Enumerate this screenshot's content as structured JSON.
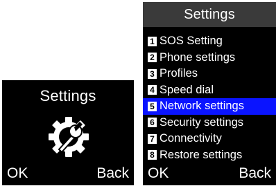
{
  "left_screen": {
    "title": "Settings",
    "icon": "gear-wrench-icon",
    "softkeys": {
      "left": "OK",
      "right": "Back"
    }
  },
  "right_screen": {
    "title": "Settings",
    "menu": [
      {
        "number": "1",
        "label": "SOS Setting"
      },
      {
        "number": "2",
        "label": "Phone settings"
      },
      {
        "number": "3",
        "label": "Profiles"
      },
      {
        "number": "4",
        "label": "Speed dial"
      },
      {
        "number": "5",
        "label": "Network settings"
      },
      {
        "number": "6",
        "label": "Security settings"
      },
      {
        "number": "7",
        "label": "Connectivity"
      },
      {
        "number": "8",
        "label": "Restore settings"
      }
    ],
    "selected_index": 4,
    "softkeys": {
      "left": "OK",
      "right": "Back"
    }
  },
  "colors": {
    "screen_bg": "#000000",
    "text": "#ffffff",
    "title_bar_bg": "#3a3a3a",
    "selection": "#0a14ff"
  }
}
